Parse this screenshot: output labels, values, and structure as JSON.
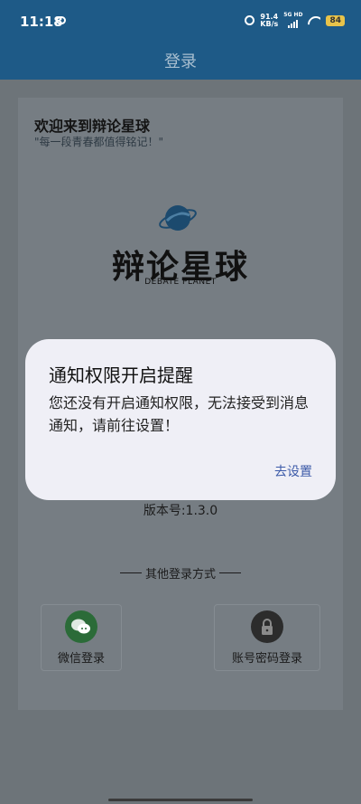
{
  "status_bar": {
    "time": "11:18",
    "net_speed_value": "91.4",
    "net_speed_unit": "KB/s",
    "network_type": "5G HD",
    "battery": "84"
  },
  "app_bar": {
    "title": "登录"
  },
  "main": {
    "welcome": "欢迎来到辩论星球",
    "quote": "\"每一段青春都值得铭记！\"",
    "logo_text": "辩论星球",
    "logo_subtitle": "DEBATE PLANET",
    "version": "版本号:1.3.0",
    "other_login": "其他登录方式",
    "login_options": [
      {
        "label": "微信登录",
        "icon": "wechat-icon"
      },
      {
        "label": "账号密码登录",
        "icon": "lock-icon"
      }
    ]
  },
  "dialog": {
    "title": "通知权限开启提醒",
    "message": "您还没有开启通知权限，无法接受到消息通知，请前往设置！",
    "action": "去设置"
  },
  "colors": {
    "app_bar": "#1e5a87",
    "dialog_action": "#3c5aa8",
    "wechat_green": "#2b6b38"
  }
}
